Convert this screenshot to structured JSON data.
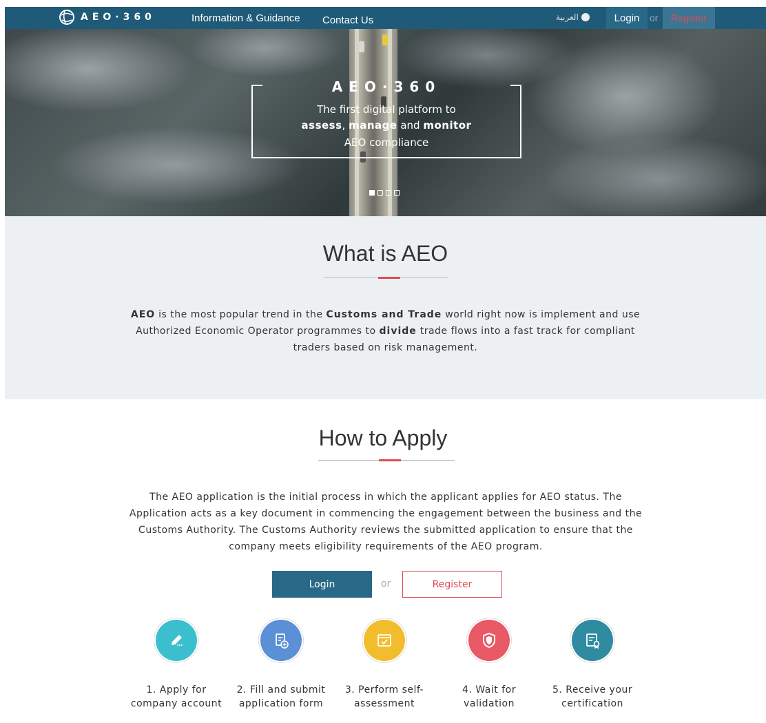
{
  "nav": {
    "logo_text": "AEO·360",
    "links": [
      "Information & Guidance",
      "Contact Us"
    ],
    "language": "العربية",
    "login": "Login",
    "or": "or",
    "register": "Register"
  },
  "hero": {
    "title": "AEO·360",
    "line1": "The first digital platform to",
    "line2_parts": [
      "assess",
      ", ",
      "manage",
      " and ",
      "monitor"
    ],
    "line3": "AEO compliance",
    "slides": 4,
    "active_slide": 1
  },
  "what": {
    "title": "What is AEO",
    "text_parts": [
      "AEO",
      " is the most popular trend in the ",
      "Customs and Trade",
      " world right now is implement and use Authorized Economic Operator programmes to ",
      "divide",
      " trade flows into a fast track for compliant traders based on risk management."
    ]
  },
  "how": {
    "title": "How to Apply",
    "text": "The AEO application is the initial process in which the applicant applies for AEO status. The Application acts as a key document in commencing the engagement between the business and the Customs Authority. The Customs Authority reviews the submitted application to ensure that the company meets eligibility requirements of the AEO program.",
    "login": "Login",
    "or": "or",
    "register": "Register"
  },
  "steps": [
    {
      "label": "1. Apply for company account",
      "icon": "edit-icon",
      "color": "#3bbfcf"
    },
    {
      "label": "2. Fill and submit application form",
      "icon": "form-add-icon",
      "color": "#5b8fd6"
    },
    {
      "label": "3. Perform self-assessment",
      "icon": "checklist-icon",
      "color": "#f2bd2c"
    },
    {
      "label": "4. Wait for validation",
      "icon": "shield-icon",
      "color": "#e85a66"
    },
    {
      "label": "5. Receive your certification",
      "icon": "certificate-icon",
      "color": "#2f8ba0"
    }
  ],
  "colors": {
    "nav_bg": "#1f5b78",
    "primary": "#2a6888",
    "accent": "#e04a55",
    "section_bg": "#edf0f3"
  }
}
